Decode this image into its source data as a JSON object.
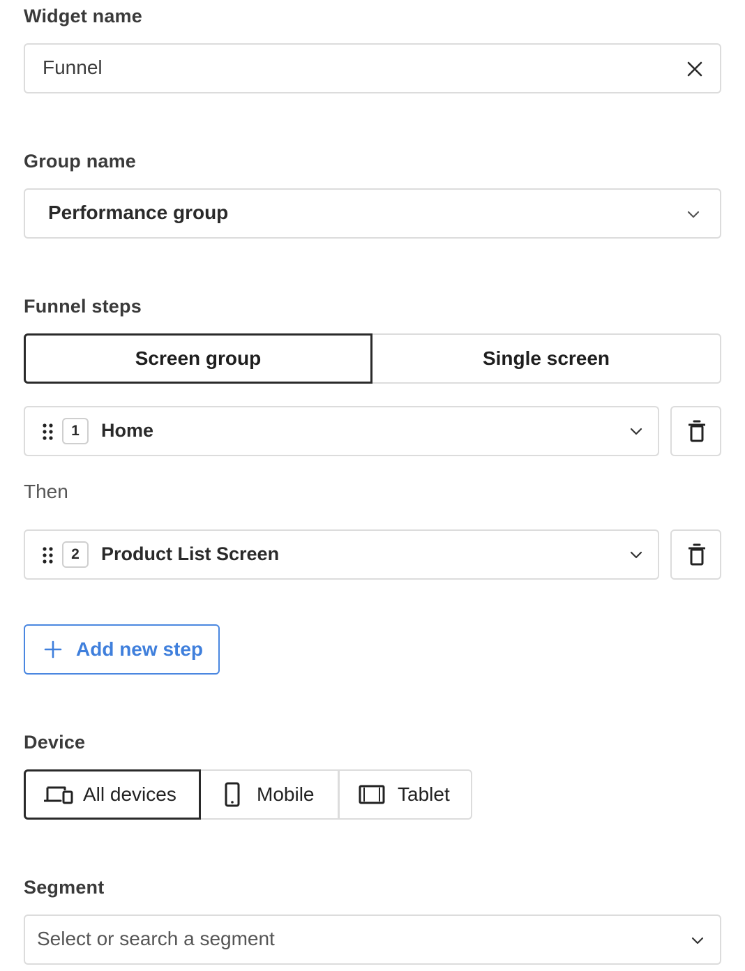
{
  "widget_name": {
    "label": "Widget name",
    "value": "Funnel"
  },
  "group_name": {
    "label": "Group name",
    "value": "Performance group"
  },
  "funnel_steps": {
    "label": "Funnel steps",
    "mode_options": [
      "Screen group",
      "Single screen"
    ],
    "selected_mode": "Screen group",
    "steps": [
      {
        "number": "1",
        "value": "Home"
      },
      {
        "number": "2",
        "value": "Product List Screen"
      }
    ],
    "separator": "Then",
    "add_label": "Add new step"
  },
  "device": {
    "label": "Device",
    "options": [
      {
        "label": "All devices",
        "icon": "devices-icon"
      },
      {
        "label": "Mobile",
        "icon": "phone-icon"
      },
      {
        "label": "Tablet",
        "icon": "tablet-icon"
      }
    ],
    "selected": "All devices"
  },
  "segment": {
    "label": "Segment",
    "placeholder": "Select or search a segment"
  }
}
